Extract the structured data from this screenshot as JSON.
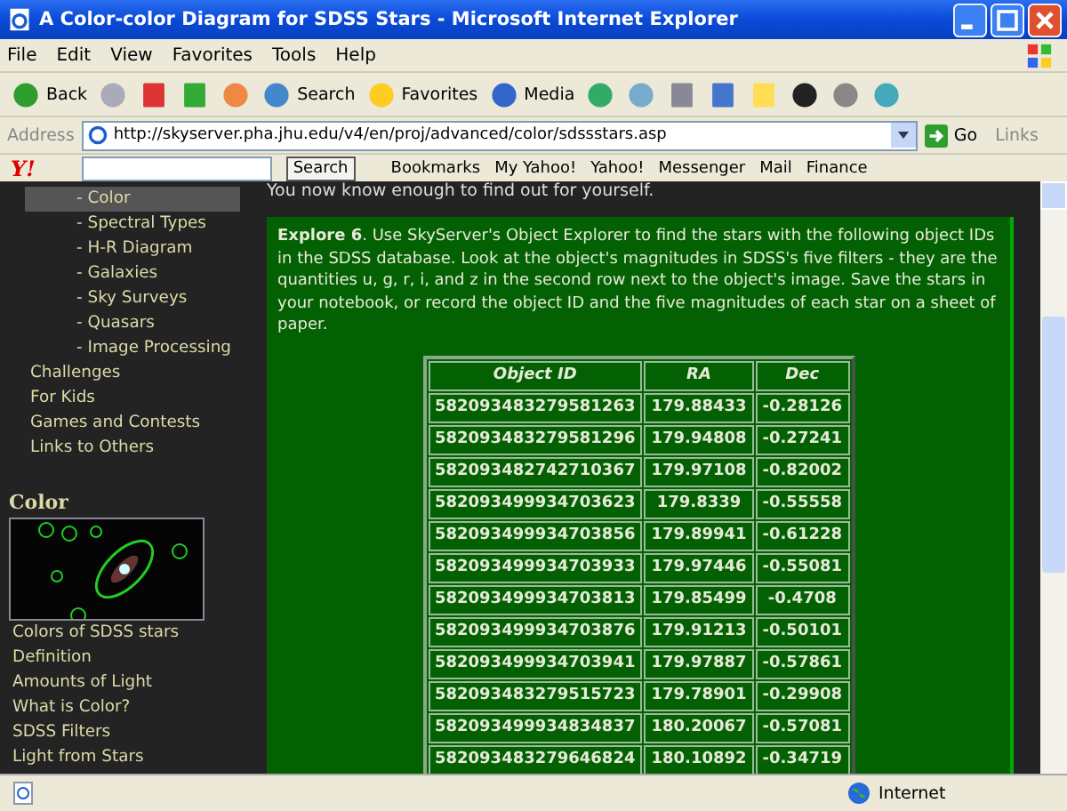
{
  "window": {
    "title": "A Color-color Diagram for SDSS Stars - Microsoft Internet Explorer"
  },
  "menu": [
    "File",
    "Edit",
    "View",
    "Favorites",
    "Tools",
    "Help"
  ],
  "toolbar": [
    "Back",
    "Search",
    "Favorites",
    "Media"
  ],
  "address": {
    "label": "Address",
    "url": "http://skyserver.pha.jhu.edu/v4/en/proj/advanced/color/sdssstars.asp",
    "go": "Go",
    "links": "Links"
  },
  "yahoo_bar": {
    "logo": "Y!",
    "search_button": "Search",
    "items": [
      "Bookmarks",
      "My Yahoo!",
      "Yahoo!",
      "Messenger",
      "Mail",
      "Finance"
    ]
  },
  "sidebar": {
    "items": [
      {
        "label": "- Color",
        "kind": "sub",
        "selected": true
      },
      {
        "label": "- Spectral Types",
        "kind": "sub",
        "selected": false
      },
      {
        "label": "- H-R Diagram",
        "kind": "sub",
        "selected": false
      },
      {
        "label": "- Galaxies",
        "kind": "sub",
        "selected": false
      },
      {
        "label": "- Sky Surveys",
        "kind": "sub",
        "selected": false
      },
      {
        "label": "- Quasars",
        "kind": "sub",
        "selected": false
      },
      {
        "label": "- Image Processing",
        "kind": "sub",
        "selected": false
      },
      {
        "label": "Challenges",
        "kind": "top",
        "selected": false
      },
      {
        "label": "For Kids",
        "kind": "top",
        "selected": false
      },
      {
        "label": "Games and Contests",
        "kind": "top",
        "selected": false
      },
      {
        "label": "Links to Others",
        "kind": "top",
        "selected": false
      }
    ],
    "section_title": "Color",
    "links": [
      "Colors of SDSS stars",
      "Definition",
      "Amounts of Light",
      "What is Color?",
      "SDSS Filters",
      "Light from Stars"
    ]
  },
  "content": {
    "intro": "You now know enough to find out for yourself.",
    "explore": "**Explore 6**. Use SkyServer's Object Explorer to find the stars with the following object IDs in the SDSS database. Look at the object's magnitudes in SDSS's five filters - they are the quantities u, g, r, i, and z in the second row next to the object's image. Save the stars in your notebook, or record the object ID and the five magnitudes of each star on a sheet of paper.",
    "table": {
      "columns": [
        "Object ID",
        "RA",
        "Dec"
      ],
      "rows": [
        [
          "582093483279581263",
          "179.88433",
          "-0.28126"
        ],
        [
          "582093483279581296",
          "179.94808",
          "-0.27241"
        ],
        [
          "582093482742710367",
          "179.97108",
          "-0.82002"
        ],
        [
          "582093499934703623",
          "179.8339",
          "-0.55558"
        ],
        [
          "582093499934703856",
          "179.89941",
          "-0.61228"
        ],
        [
          "582093499934703933",
          "179.97446",
          "-0.55081"
        ],
        [
          "582093499934703813",
          "179.85499",
          "-0.4708"
        ],
        [
          "582093499934703876",
          "179.91213",
          "-0.50101"
        ],
        [
          "582093499934703941",
          "179.97887",
          "-0.57861"
        ],
        [
          "582093483279515723",
          "179.78901",
          "-0.29908"
        ],
        [
          "582093499934834837",
          "180.20067",
          "-0.57081"
        ],
        [
          "582093483279646824",
          "180.10892",
          "-0.34719"
        ]
      ]
    }
  },
  "status_bar": {
    "zone": "Internet"
  }
}
